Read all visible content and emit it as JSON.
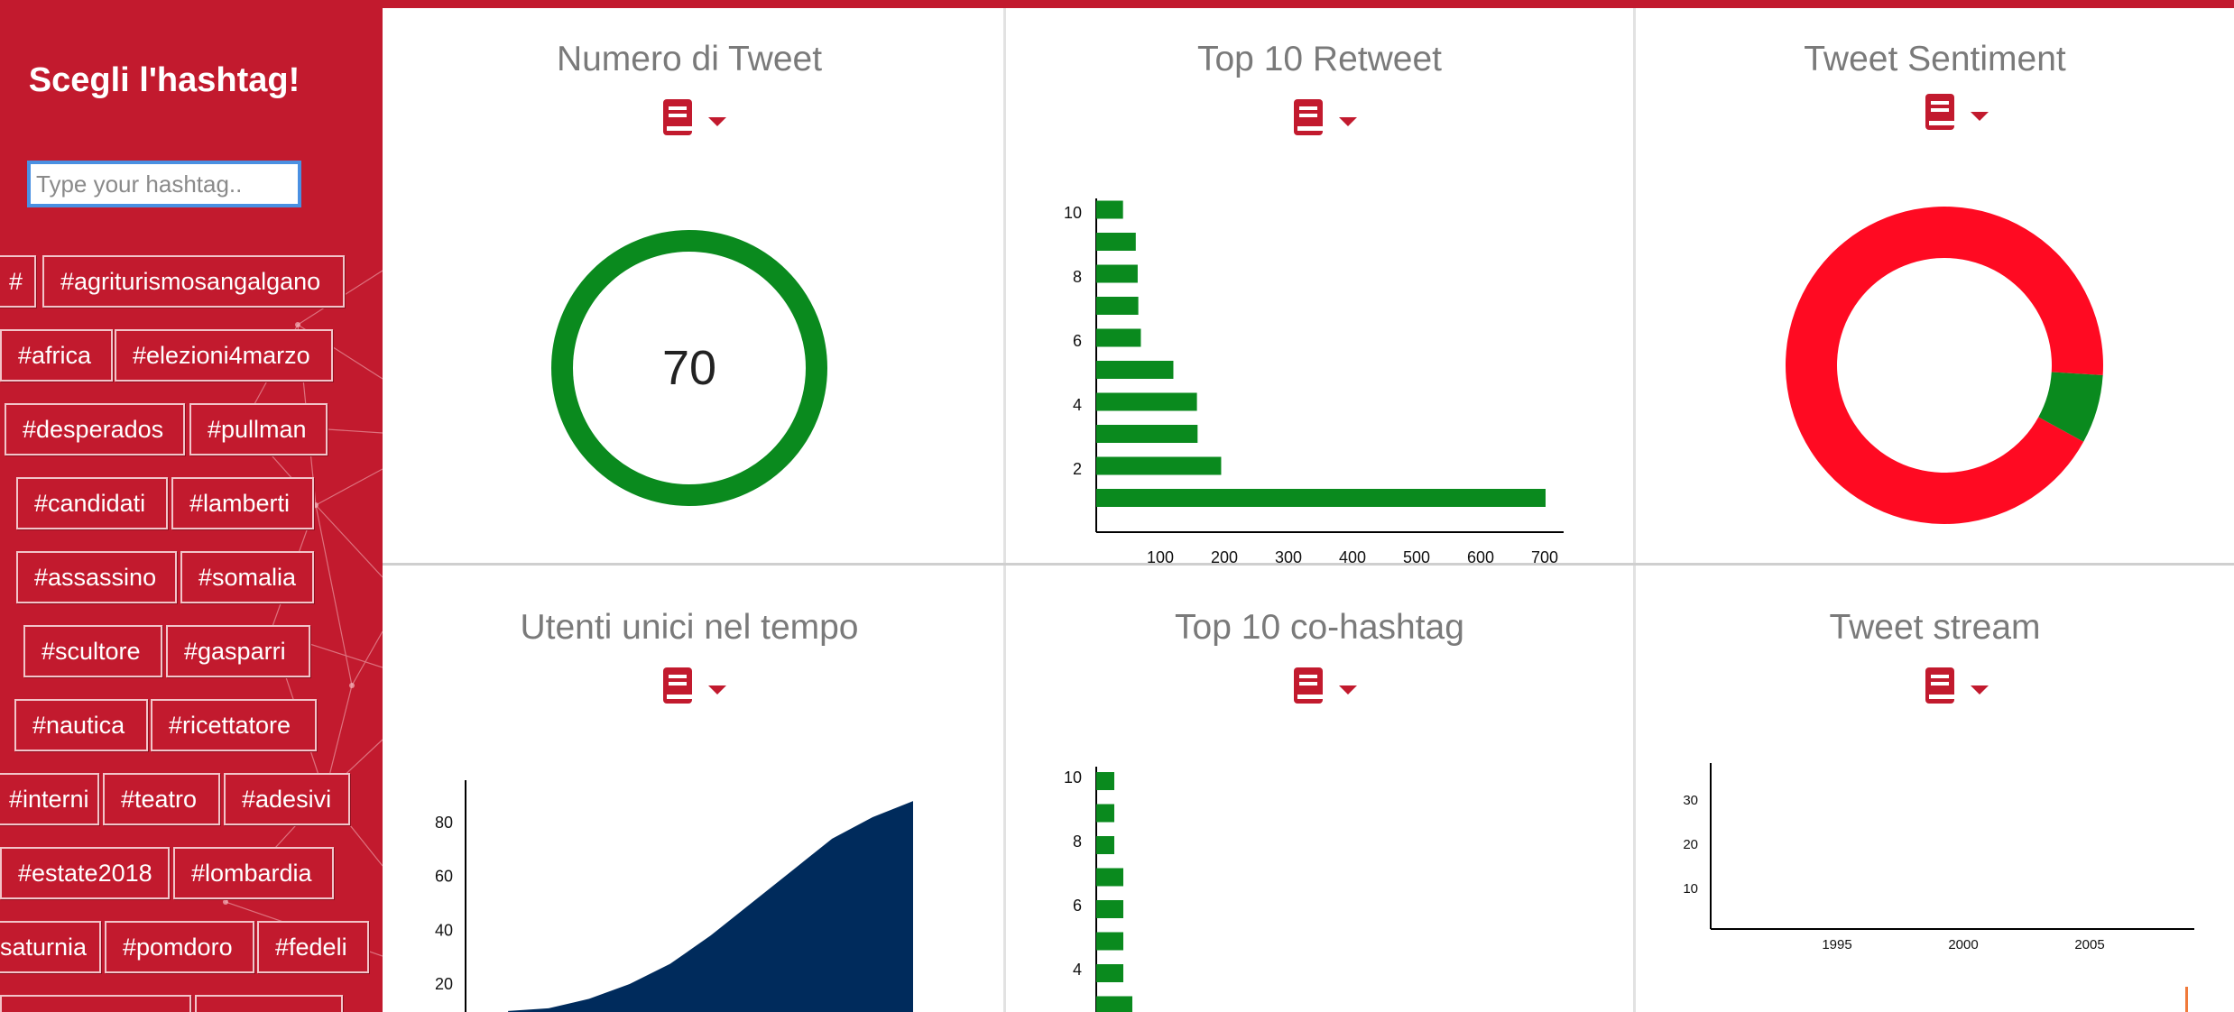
{
  "sidebar": {
    "title": "Scegli l'hashtag!",
    "search_placeholder": "Type your hashtag..",
    "hashtags": [
      "#",
      "#agriturismosangalgano",
      "#africa",
      "#elezioni4marzo",
      "#desperados",
      "#pullman",
      "#candidati",
      "#lamberti",
      "#assassino",
      "#somalia",
      "#scultore",
      "#gasparri",
      "#nautica",
      "#ricettatore",
      "#interni",
      "#teatro",
      "#adesivi",
      "#estate2018",
      "#lombardia",
      "saturnia",
      "#pomdoro",
      "#fedeli"
    ]
  },
  "panels": {
    "tweet_count": {
      "title": "Numero di Tweet",
      "value": "70"
    },
    "top_retweet": {
      "title": "Top 10 Retweet"
    },
    "sentiment": {
      "title": "Tweet Sentiment"
    },
    "unique_users": {
      "title": "Utenti unici nel tempo"
    },
    "top_cohashtag": {
      "title": "Top 10 co-hashtag"
    },
    "tweet_stream": {
      "title": "Tweet stream"
    }
  },
  "icons": {
    "panel_menu": [
      "book-icon",
      "caret-down-icon"
    ]
  },
  "colors": {
    "brand_red": "#c21a2e",
    "positive_green": "#0a8a1e",
    "negative_red": "#ff0a22",
    "area_navy": "#002b5c"
  },
  "chart_data": [
    {
      "type": "bar",
      "orientation": "horizontal",
      "categories": [
        "1",
        "2",
        "3",
        "4",
        "5",
        "6",
        "7",
        "8",
        "9",
        "10"
      ],
      "values": [
        705,
        196,
        159,
        158,
        121,
        70,
        66,
        65,
        62,
        42
      ],
      "y_ticks": [
        "2",
        "4",
        "6",
        "8",
        "10"
      ],
      "x_ticks": [
        "100",
        "200",
        "300",
        "400",
        "500",
        "600",
        "700"
      ],
      "xlim": [
        0,
        705
      ]
    },
    {
      "type": "pie",
      "style": "donut",
      "slices": [
        {
          "value": 0.93,
          "color": "#ff0a22"
        },
        {
          "value": 0.07,
          "color": "#0a8a1e"
        }
      ]
    },
    {
      "type": "area",
      "y_ticks": [
        "20",
        "40",
        "60",
        "80"
      ],
      "ylim": [
        10,
        90
      ],
      "points": [
        [
          0,
          10
        ],
        [
          0.1,
          11
        ],
        [
          0.2,
          14.5
        ],
        [
          0.3,
          20
        ],
        [
          0.4,
          27.5
        ],
        [
          0.5,
          38
        ],
        [
          0.6,
          50
        ],
        [
          0.7,
          62
        ],
        [
          0.8,
          74
        ],
        [
          0.9,
          82
        ],
        [
          1,
          88
        ]
      ]
    },
    {
      "type": "bar",
      "orientation": "horizontal",
      "categories": [
        "10",
        "9",
        "8",
        "7",
        "6",
        "5",
        "4",
        "3"
      ],
      "values": [
        20,
        20,
        20,
        30,
        30,
        30,
        30,
        40
      ],
      "y_ticks": [
        "4",
        "6",
        "8",
        "10"
      ]
    },
    {
      "type": "line",
      "y_ticks": [
        "10",
        "20",
        "30"
      ],
      "x_ticks": [
        "1995",
        "2000",
        "2005"
      ],
      "series": []
    }
  ]
}
